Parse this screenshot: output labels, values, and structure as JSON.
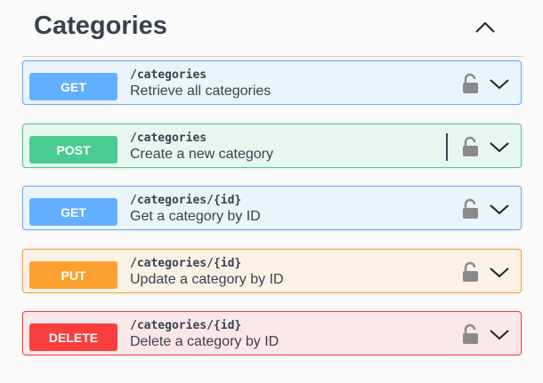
{
  "section": {
    "title": "Categories"
  },
  "operations": [
    {
      "method": "GET",
      "path": "/categories",
      "summary": "Retrieve all categories"
    },
    {
      "method": "POST",
      "path": "/categories",
      "summary": "Create a new category"
    },
    {
      "method": "GET",
      "path": "/categories/{id}",
      "summary": "Get a category by ID"
    },
    {
      "method": "PUT",
      "path": "/categories/{id}",
      "summary": "Update a category by ID"
    },
    {
      "method": "DELETE",
      "path": "/categories/{id}",
      "summary": "Delete a category by ID"
    }
  ],
  "colors": {
    "get": "#61affe",
    "post": "#49cc90",
    "put": "#fca130",
    "delete": "#f93e3e",
    "text": "#3b4151"
  },
  "icons": {
    "lock": "lock-icon",
    "expand": "chevron-down-icon",
    "collapse": "chevron-up-icon"
  }
}
